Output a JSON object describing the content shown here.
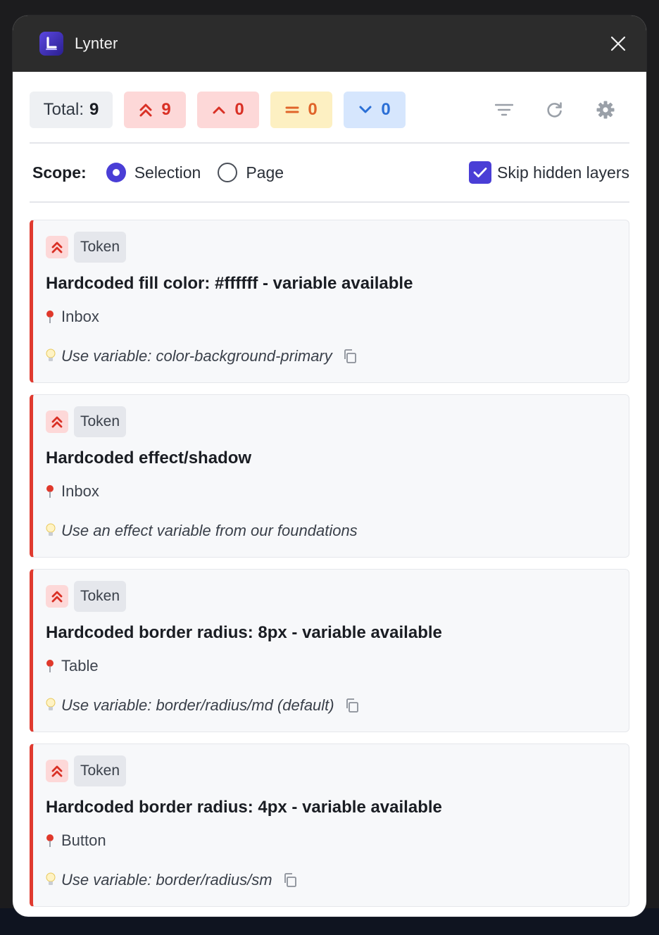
{
  "app": {
    "title": "Lynter"
  },
  "stats": {
    "total_label": "Total:",
    "total_value": "9",
    "critical": "9",
    "high": "0",
    "medium": "0",
    "low": "0"
  },
  "scope": {
    "label": "Scope:",
    "options": [
      "Selection",
      "Page"
    ],
    "selected": "Selection",
    "skip_hidden_label": "Skip hidden layers",
    "skip_hidden_checked": true
  },
  "issues": [
    {
      "severity": "critical",
      "type": "Token",
      "title": "Hardcoded fill color: #ffffff - variable available",
      "location": "Inbox",
      "hint": "Use variable: color-background-primary",
      "copyable": true
    },
    {
      "severity": "critical",
      "type": "Token",
      "title": "Hardcoded effect/shadow",
      "location": "Inbox",
      "hint": "Use an effect variable from our foundations",
      "copyable": false
    },
    {
      "severity": "critical",
      "type": "Token",
      "title": "Hardcoded border radius: 8px - variable available",
      "location": "Table",
      "hint": "Use variable: border/radius/md (default)",
      "copyable": true
    },
    {
      "severity": "critical",
      "type": "Token",
      "title": "Hardcoded border radius: 4px - variable available",
      "location": "Button",
      "hint": "Use variable: border/radius/sm",
      "copyable": true
    }
  ],
  "colors": {
    "accent": "#4a3ed6",
    "critical": "#d93025",
    "critical_bg": "#fdd8d8",
    "medium": "#e0642a",
    "medium_bg": "#fdf0c2",
    "low": "#2b6fd6",
    "low_bg": "#d6e6fd"
  },
  "icons": [
    "app-logo-icon",
    "close-icon",
    "chevrons-up-icon",
    "chevron-up-icon",
    "equals-icon",
    "chevron-down-icon",
    "filter-icon",
    "refresh-icon",
    "gear-icon",
    "check-icon",
    "pin-icon",
    "bulb-icon",
    "copy-icon"
  ]
}
